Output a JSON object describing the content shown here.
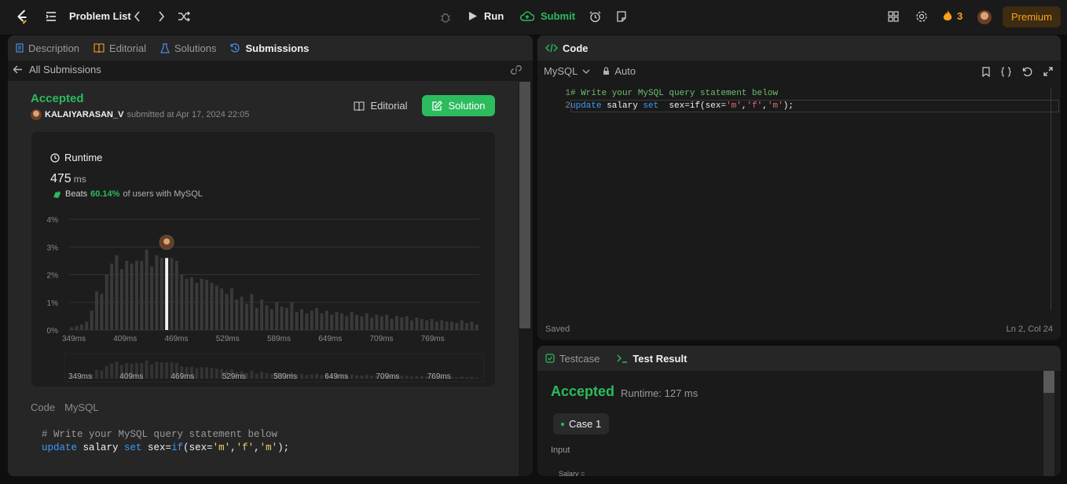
{
  "topbar": {
    "problem_list": "Problem List",
    "run": "Run",
    "submit": "Submit",
    "streak": "3",
    "premium": "Premium"
  },
  "left_tabs": [
    "Description",
    "Editorial",
    "Solutions",
    "Submissions"
  ],
  "submission": {
    "back": "All Submissions",
    "status": "Accepted",
    "user": "KALAIYARASAN_V",
    "submitted_text": "submitted at Apr 17, 2024 22:05",
    "editorial_btn": "Editorial",
    "solution_btn": "Solution"
  },
  "runtime": {
    "label": "Runtime",
    "value": "475",
    "unit": "ms",
    "beats_prefix": "Beats",
    "beats_pct": "60.14%",
    "beats_suffix": "of users with MySQL"
  },
  "chart_data": {
    "type": "bar",
    "y_ticks": [
      "4%",
      "3%",
      "2%",
      "1%",
      "0%"
    ],
    "ylim": [
      0,
      4
    ],
    "x_ticks": [
      "349ms",
      "409ms",
      "469ms",
      "529ms",
      "589ms",
      "649ms",
      "709ms",
      "769ms"
    ],
    "highlight_index": 19,
    "values": [
      0.1,
      0.15,
      0.2,
      0.3,
      0.7,
      1.4,
      1.3,
      2.0,
      2.4,
      2.7,
      2.2,
      2.5,
      2.4,
      2.5,
      2.5,
      2.9,
      2.3,
      2.7,
      2.6,
      2.6,
      2.6,
      2.5,
      2.0,
      1.85,
      1.9,
      1.7,
      1.85,
      1.8,
      1.7,
      1.6,
      1.5,
      1.3,
      1.5,
      1.1,
      1.2,
      0.95,
      1.3,
      0.8,
      1.1,
      0.9,
      0.75,
      1.0,
      0.85,
      0.8,
      1.0,
      0.65,
      0.75,
      0.6,
      0.7,
      0.8,
      0.6,
      0.7,
      0.55,
      0.65,
      0.6,
      0.5,
      0.65,
      0.55,
      0.5,
      0.6,
      0.45,
      0.55,
      0.5,
      0.55,
      0.4,
      0.5,
      0.45,
      0.5,
      0.35,
      0.45,
      0.4,
      0.35,
      0.4,
      0.3,
      0.35,
      0.3,
      0.3,
      0.25,
      0.35,
      0.25,
      0.3,
      0.2
    ]
  },
  "code_section": {
    "tab_code": "Code",
    "tab_lang": "MySQL",
    "line1": "# Write your MySQL query statement below",
    "line2_kw": "update",
    "line2_a": " salary ",
    "line2_set": "set",
    "line2_b": "  sex=",
    "line2_if": "if",
    "line2_c": "(sex=",
    "s1": "'m'",
    "s2": "'f'",
    "s3": "'m'",
    "line2_end": ");"
  },
  "editor": {
    "title": "Code",
    "lang": "MySQL",
    "mode": "Auto",
    "saved": "Saved",
    "cursor": "Ln 2, Col 24"
  },
  "result": {
    "tab_testcase": "Testcase",
    "tab_result": "Test Result",
    "status": "Accepted",
    "runtime": "Runtime: 127 ms",
    "case": "Case 1",
    "input_label": "Input",
    "salary": "Salary ="
  }
}
